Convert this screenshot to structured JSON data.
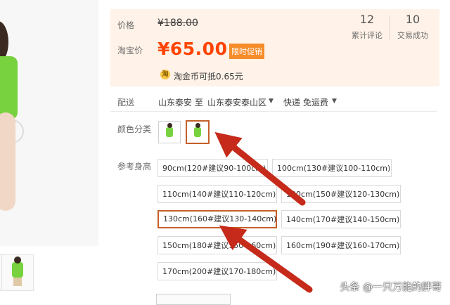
{
  "header_partial": "",
  "price": {
    "original_label": "价格",
    "original_value": "¥188.00",
    "taobao_label": "淘宝价",
    "current_value": "¥65.00",
    "promo_badge": "限时促销",
    "reviews_count": "12",
    "reviews_label": "累计评论",
    "sales_count": "10",
    "sales_label": "交易成功",
    "coin_symbol": "淘",
    "coin_text": "淘金币可抵0.65元"
  },
  "shipping": {
    "label": "配送",
    "from": "山东泰安 至",
    "to": "山东泰安泰山区",
    "method": "快递 免运费"
  },
  "color": {
    "label": "颜色分类",
    "options": [
      "green-kid-standing",
      "green-kid-sitting"
    ],
    "selected_index": 1
  },
  "size": {
    "label": "参考身高",
    "options": [
      "90cm(120#建议90-100cm)",
      "100cm(130#建议100-110cm)",
      "110cm(140#建议110-120cm)",
      "120cm(150#建议120-130cm)",
      "130cm(160#建议130-140cm)",
      "140cm(170#建议140-150cm)",
      "150cm(180#建议150-160cm)",
      "160cm(190#建议160-170cm)",
      "170cm(200#建议170-180cm)"
    ],
    "selected_index": 4
  },
  "watermark": "头条 @一只万能的胖哥",
  "colors": {
    "price_red": "#ff4400",
    "panel_bg": "#fff2e8",
    "selected_border": "#c4602a",
    "arrow_red": "#c62a1a",
    "promo_bg": "#f68c2a"
  }
}
